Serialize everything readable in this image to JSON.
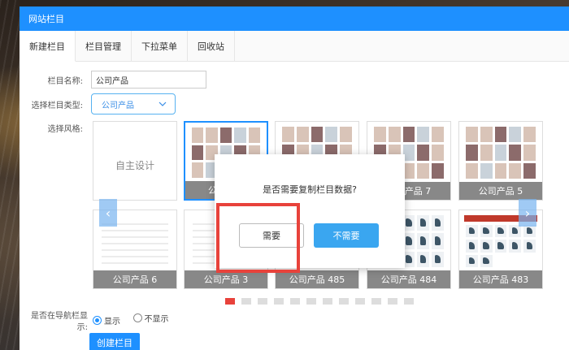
{
  "window": {
    "title": "网站栏目"
  },
  "tabs": [
    {
      "label": "新建栏目",
      "active": true
    },
    {
      "label": "栏目管理"
    },
    {
      "label": "下拉菜单"
    },
    {
      "label": "回收站"
    }
  ],
  "form": {
    "name_label": "栏目名称:",
    "name_value": "公司产品",
    "type_label": "选择栏目类型:",
    "type_value": "公司产品",
    "style_label": "选择风格:",
    "nav_label_line1": "是否在导航栏显",
    "nav_label_line2": "示:",
    "nav_options": [
      "显示",
      "不显示"
    ],
    "nav_selected": "显示",
    "create_button": "创建栏目"
  },
  "templates": {
    "row1": [
      {
        "caption": "自主设计",
        "kind": "design"
      },
      {
        "caption": "公司产品",
        "kind": "photo"
      },
      {
        "caption": "",
        "kind": "photo"
      },
      {
        "caption": "公司产品 7",
        "kind": "photo"
      },
      {
        "caption": "公司产品 5",
        "kind": "photo"
      }
    ],
    "row2": [
      {
        "caption": "公司产品 6",
        "kind": "doc"
      },
      {
        "caption": "公司产品 3",
        "kind": "doc"
      },
      {
        "caption": "公司产品 485",
        "kind": "doc"
      },
      {
        "caption": "公司产品 484",
        "kind": "tools"
      },
      {
        "caption": "公司产品 483",
        "kind": "tools"
      }
    ]
  },
  "pagination": {
    "pages": 12,
    "active": 1
  },
  "confirm_dialog": {
    "message": "是否需要复制栏目数据?",
    "yes_label": "需要",
    "no_label": "不需要"
  },
  "colors": {
    "primary": "#1e90ff",
    "highlight": "#e8423b"
  },
  "icons": {
    "select_caret": "chevron-down-icon",
    "prev": "chevron-left-icon",
    "next": "chevron-right-icon"
  }
}
